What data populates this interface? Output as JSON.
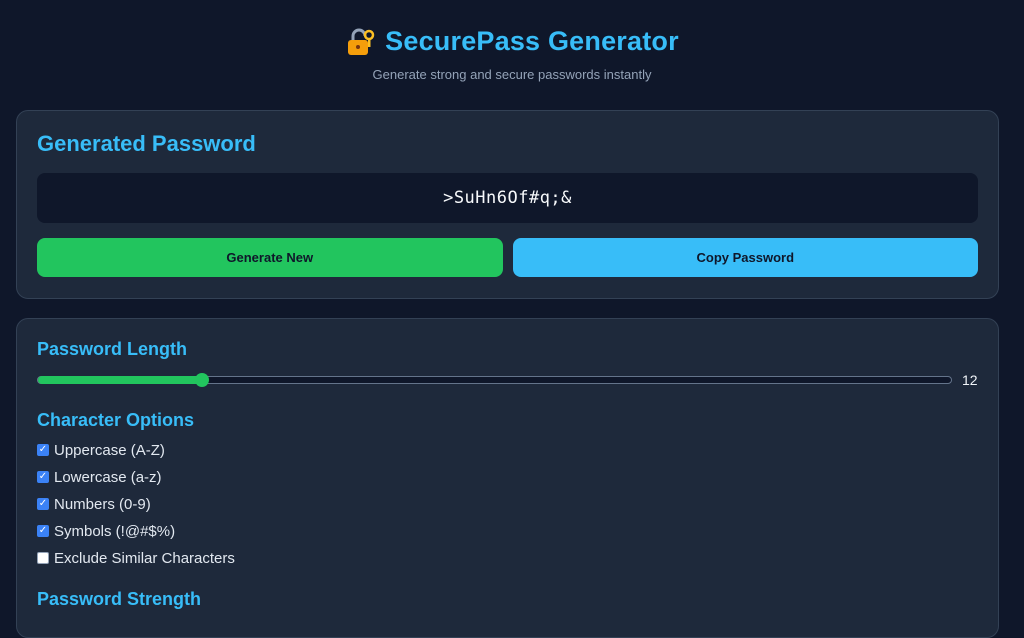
{
  "header": {
    "title": "SecurePass Generator",
    "subtitle": "Generate strong and secure passwords instantly",
    "icon": "lock-icon"
  },
  "generated": {
    "heading": "Generated Password",
    "password": ">SuHn6Of#q;&",
    "generate_label": "Generate New",
    "copy_label": "Copy Password"
  },
  "length": {
    "heading": "Password Length",
    "value": 12,
    "display": "12",
    "fraction": 0.18
  },
  "options": {
    "heading": "Character Options",
    "items": [
      {
        "label": "Uppercase (A-Z)",
        "checked": true
      },
      {
        "label": "Lowercase (a-z)",
        "checked": true
      },
      {
        "label": "Numbers (0-9)",
        "checked": true
      },
      {
        "label": "Symbols (!@#$%)",
        "checked": true
      },
      {
        "label": "Exclude Similar Characters",
        "checked": false
      }
    ]
  },
  "strength": {
    "heading": "Password Strength"
  },
  "colors": {
    "background": "#0f172a",
    "card": "#1e293b",
    "accent": "#38bdf8",
    "generate": "#22c55e",
    "checkbox": "#3b82f6"
  }
}
